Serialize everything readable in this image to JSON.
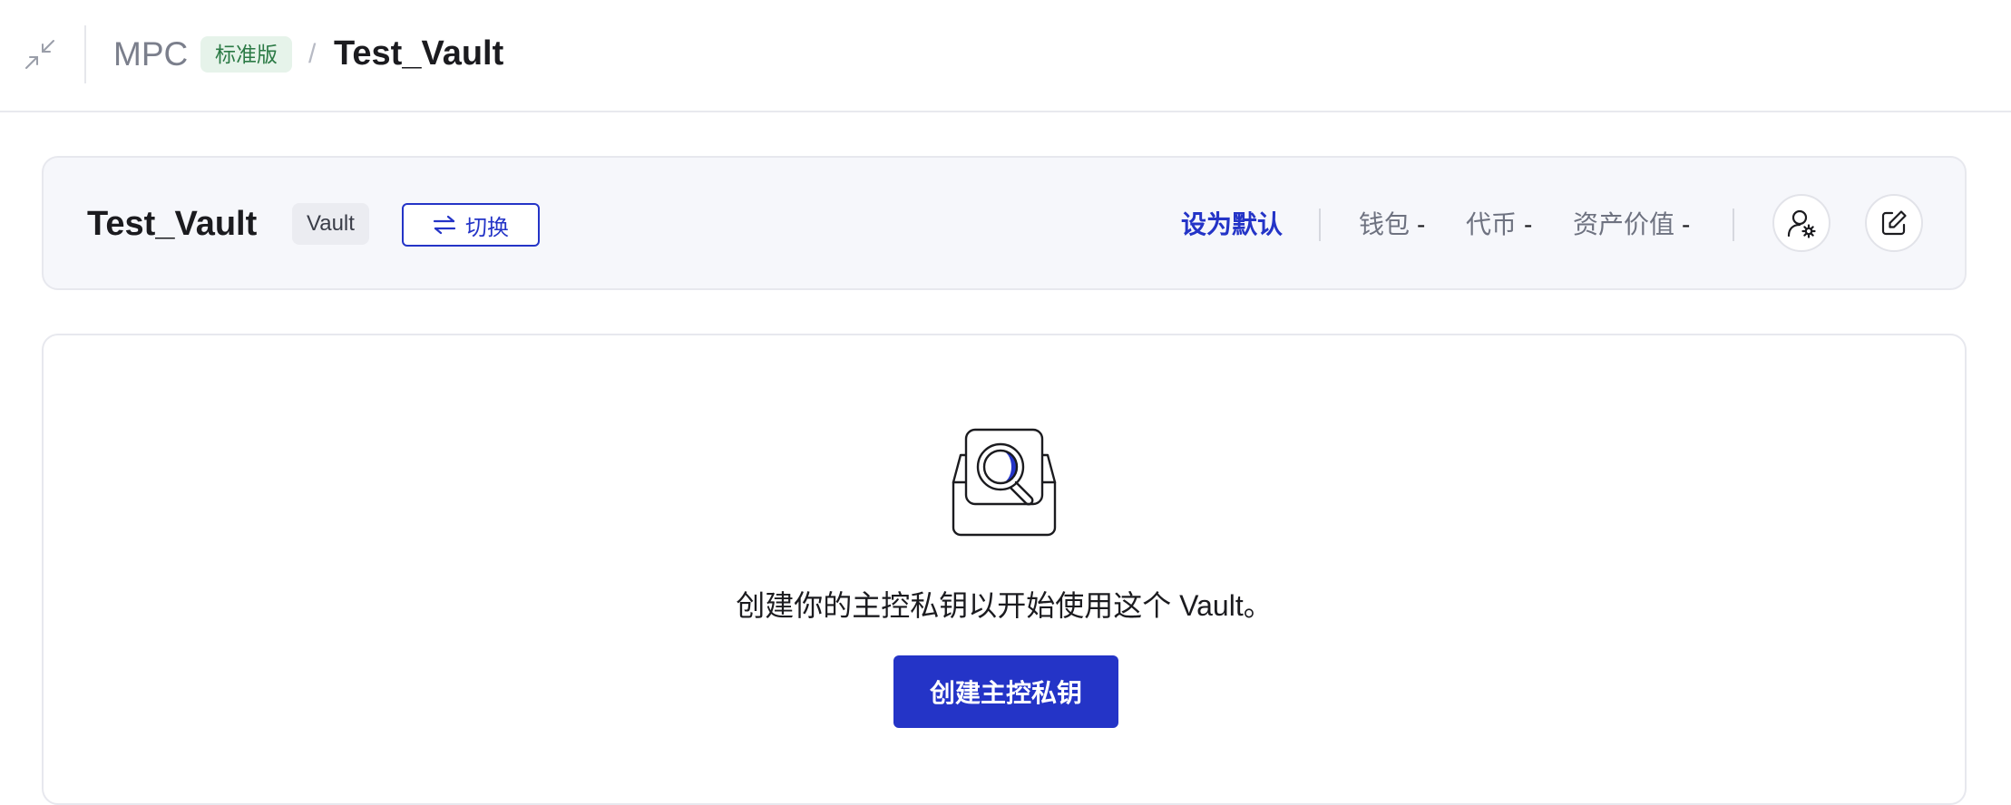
{
  "header": {
    "breadcrumb_root": "MPC",
    "edition_badge": "标准版",
    "separator": "/",
    "current": "Test_Vault"
  },
  "vault_card": {
    "name": "Test_Vault",
    "type_tag": "Vault",
    "switch_label": "切换",
    "set_default_label": "设为默认",
    "stats": [
      {
        "label": "钱包",
        "value": "-"
      },
      {
        "label": "代币",
        "value": "-"
      },
      {
        "label": "资产价值",
        "value": "-"
      }
    ]
  },
  "empty_state": {
    "message": "创建你的主控私钥以开始使用这个 Vault。",
    "cta_label": "创建主控私钥"
  },
  "colors": {
    "accent": "#2434c7",
    "badge_bg": "#e6f3ea",
    "badge_text": "#2b7a45",
    "card_bg": "#f6f7fb"
  },
  "icons": {
    "collapse": "collapse-arrows-icon",
    "switch": "swap-arrows-icon",
    "member_settings": "user-gear-icon",
    "edit": "edit-icon",
    "empty": "search-inbox-icon"
  }
}
